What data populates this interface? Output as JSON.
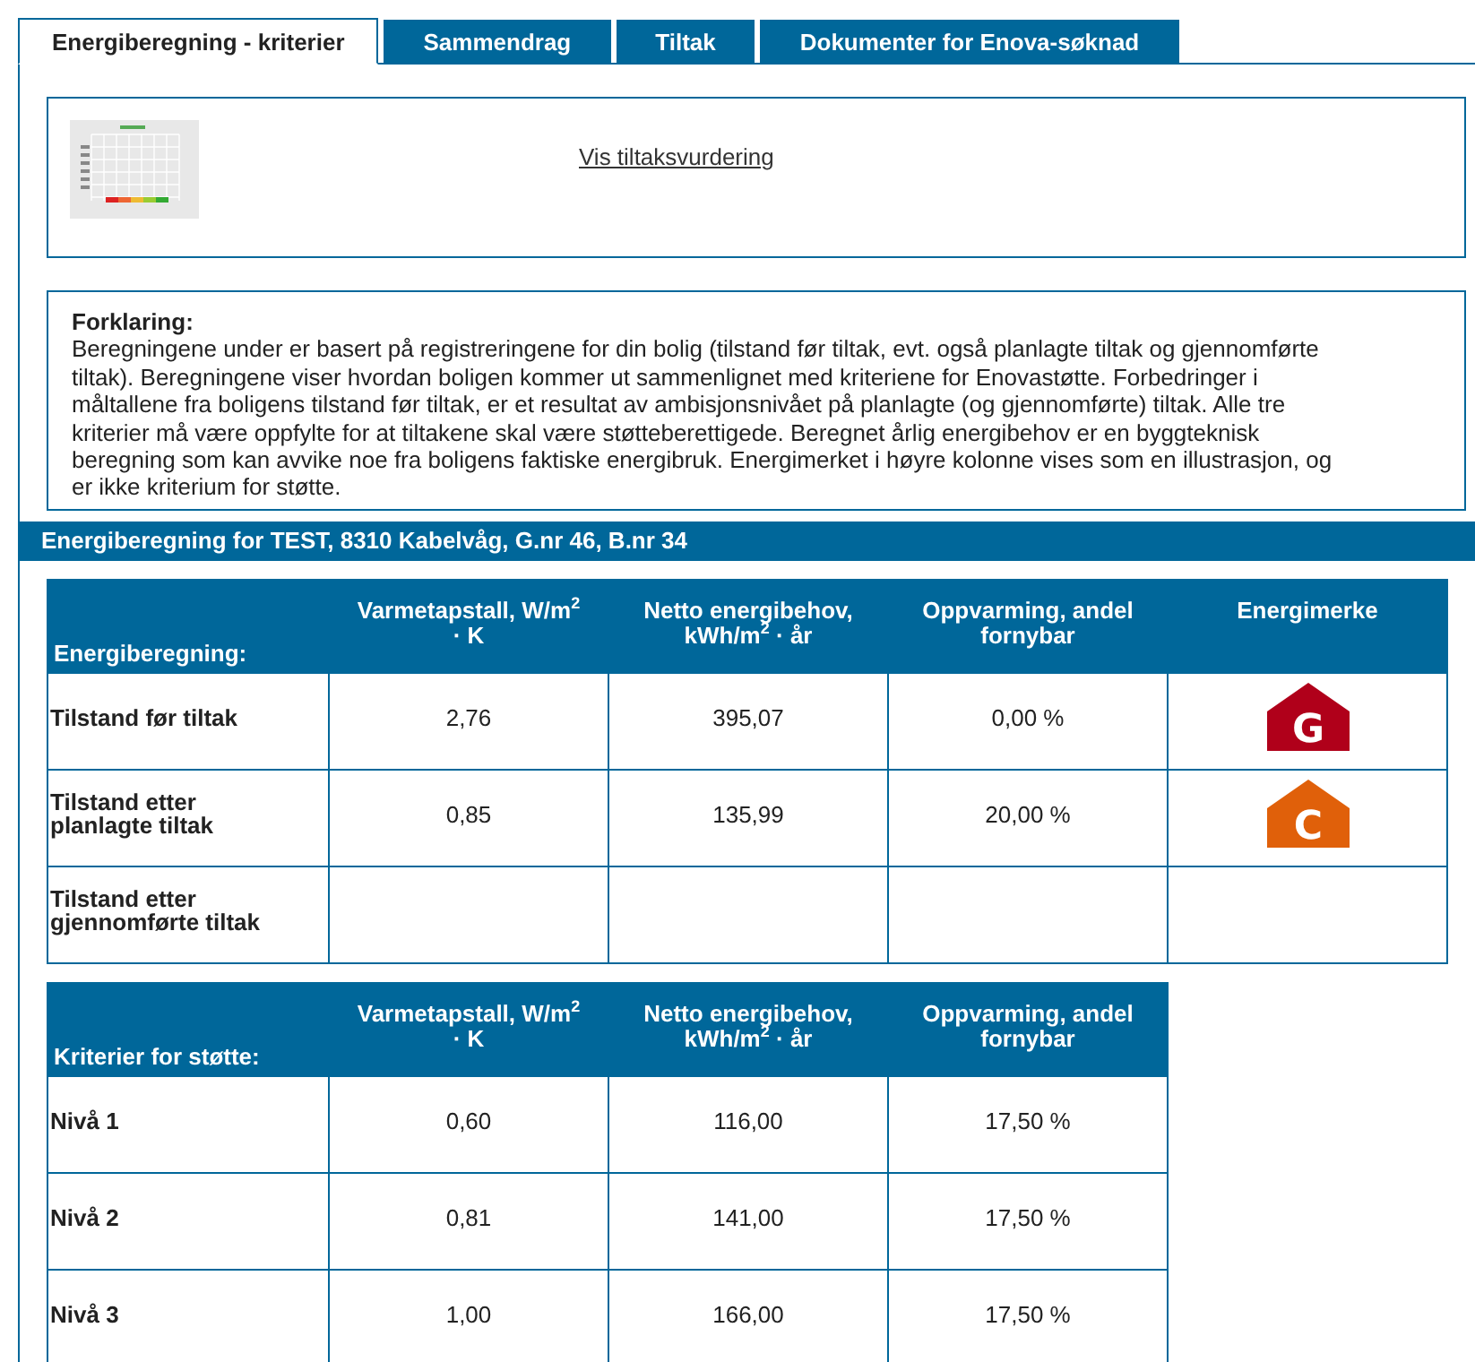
{
  "tabs": [
    {
      "label": "Energiberegning - kriterier",
      "selected": true
    },
    {
      "label": "Sammendrag",
      "selected": false
    },
    {
      "label": "Tiltak",
      "selected": false
    },
    {
      "label": "Dokumenter for Enova-søknad",
      "selected": false
    }
  ],
  "preview": {
    "link": "Vis tiltaksvurdering"
  },
  "explanation": {
    "title": "Forklaring:",
    "text": "Beregningene under er basert på registreringene for din bolig (tilstand før tiltak, evt. også planlagte tiltak og gjennomførte tiltak). Beregningene viser hvordan boligen kommer ut sammenlignet med kriteriene for Enovastøtte. Forbedringer i måltallene fra boligens tilstand før tiltak, er et resultat av ambisjonsnivået på planlagte (og gjennomførte) tiltak. Alle tre kriterier må være oppfylte for at tiltakene skal være støtteberettigede. Beregnet årlig energibehov er en byggteknisk beregning som kan avvike noe fra boligens faktiske energibruk. Energimerket i høyre kolonne vises som en illustrasjon, og er ikke kriterium for støtte."
  },
  "section_title": "Energiberegning for TEST, 8310 Kabelvåg, G.nr 46, B.nr 34",
  "calculation_table": {
    "columns": [
      "Energiberegning:",
      "Varmetapstall, W/m$^{2}$ · K",
      "Netto energibehov, kWh/m$^{2}$ · år",
      "Oppvarming, andel fornybar",
      "Energimerke"
    ],
    "rows": [
      {
        "cells": [
          "Tilstand før tiltak",
          "2,76",
          "395,07",
          "0,00 %"
        ],
        "energy_label": {
          "letter": "G",
          "color": "#b0001a"
        }
      },
      {
        "cells": [
          "Tilstand etter planlagte tiltak",
          "0,85",
          "135,99",
          "20,00 %"
        ],
        "energy_label": {
          "letter": "C",
          "color": "#e0600a"
        }
      },
      {
        "cells": [
          "Tilstand etter gjennomførte tiltak",
          "",
          "",
          ""
        ]
      }
    ]
  },
  "criteria_table": {
    "columns": [
      "Kriterier for støtte:",
      "Varmetapstall, W/m$^{2}$ · K",
      "Netto energibehov, kWh/m$^{2}$ · år",
      "Oppvarming, andel fornybar"
    ],
    "rows": [
      {
        "cells": [
          "Nivå 1",
          "0,60",
          "116,00",
          "17,50 %"
        ]
      },
      {
        "cells": [
          "Nivå 2",
          "0,81",
          "141,00",
          "17,50 %"
        ]
      },
      {
        "cells": [
          "Nivå 3",
          "1,00",
          "166,00",
          "17,50 %"
        ]
      }
    ]
  }
}
